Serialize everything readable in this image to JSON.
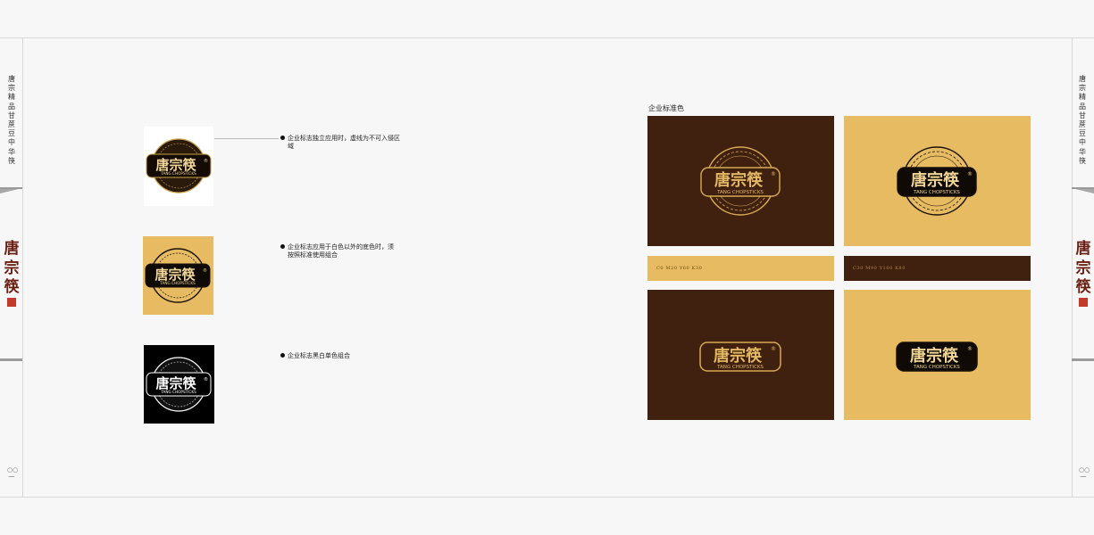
{
  "side_title": "唐宗精品甘蔗豆中华筷",
  "seal_chars": [
    "唐",
    "宗",
    "筷"
  ],
  "page_number": "○○一",
  "logo": {
    "main_text": "唐宗筷",
    "sub_text": "TANG CHOPSTICKS",
    "registered_mark": "®"
  },
  "rules": [
    {
      "text": "企业标志独立应用时，虚线为不可入侵区域"
    },
    {
      "text": "企业标志应用于白色以外的底色时，须按照标准使用组合"
    },
    {
      "text": "企业标志黑白单色组合"
    }
  ],
  "standard_colors": {
    "heading": "企业标准色",
    "color_a": {
      "code": "C0  M20 Y60 K30",
      "hex": "#e7bb62"
    },
    "color_b": {
      "code": "C30  M90 Y100 K80",
      "hex": "#40200f"
    }
  },
  "colors": {
    "brown": "#40200f",
    "gold": "#e7bb62",
    "dark_gold": "#c9a048",
    "black": "#000000"
  }
}
